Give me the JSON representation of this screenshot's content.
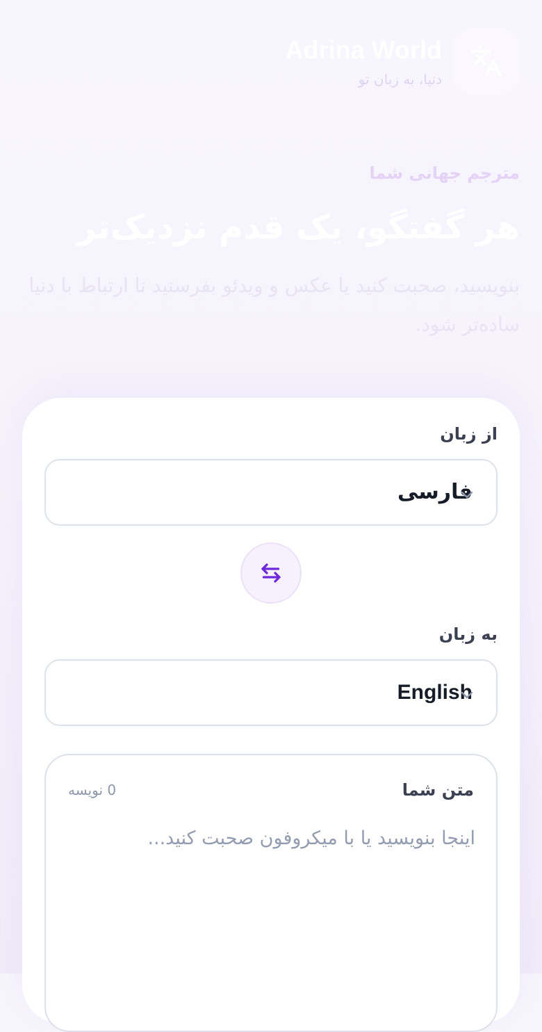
{
  "header": {
    "brand_name": "Adrina World",
    "tagline": "دنیا، به زبان تو",
    "logo_icon": "translate-icon"
  },
  "hero": {
    "eyebrow": "مترجم جهانی شما",
    "title": "هر گفتگو، یک قدم نزدیک‌تر",
    "subtitle": "بنویسید، صحبت کنید یا عکس و ویدئو بفرستید تا ارتباط با دنیا ساده‌تر شود."
  },
  "translator": {
    "from_label": "از زبان",
    "from_value": "فارسی",
    "swap_icon": "swap-arrows-icon",
    "to_label": "به زبان",
    "to_value": "English",
    "text_title": "متن شما",
    "char_count": "0 نویسه",
    "text_value": "",
    "text_placeholder": "اینجا بنویسید یا با میکروفون صحبت کنید..."
  },
  "colors": {
    "accent": "#6d28d9",
    "eyebrow": "#e4d2f7",
    "border": "#dde2ea"
  }
}
